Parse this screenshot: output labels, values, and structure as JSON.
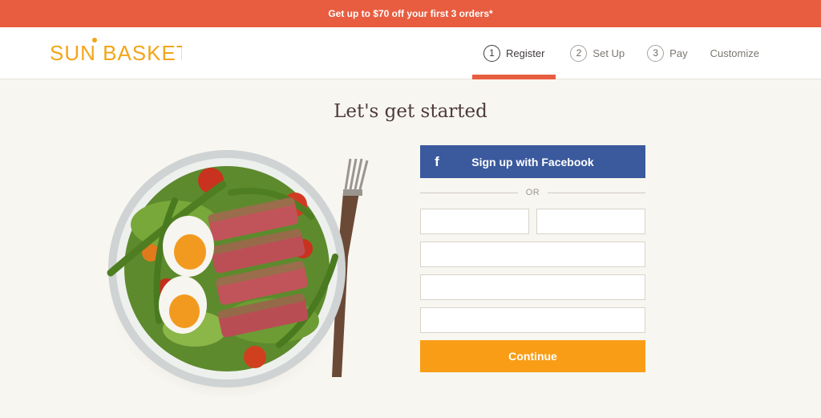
{
  "promo": {
    "text": "Get up to $70 off your first 3 orders*"
  },
  "brand": {
    "logo_text": "SUN BASKET",
    "color": "#f2a51a"
  },
  "steps": [
    {
      "number": "1",
      "label": "Register",
      "active": true
    },
    {
      "number": "2",
      "label": "Set Up",
      "active": false
    },
    {
      "number": "3",
      "label": "Pay",
      "active": false
    },
    {
      "label": "Customize",
      "active": false
    }
  ],
  "page": {
    "title": "Let's get started"
  },
  "form": {
    "facebook_icon": "f",
    "facebook_label": "Sign up with Facebook",
    "divider_text": "OR",
    "first_name": {
      "value": "",
      "placeholder": ""
    },
    "last_name": {
      "value": "",
      "placeholder": ""
    },
    "email": {
      "value": "",
      "placeholder": ""
    },
    "password": {
      "value": "",
      "placeholder": ""
    },
    "zip": {
      "value": "",
      "placeholder": ""
    },
    "continue_label": "Continue"
  },
  "colors": {
    "promo_bg": "#e85d40",
    "facebook": "#3b5a9d",
    "continue": "#fa9d16",
    "active_step_underline": "#e85d40"
  },
  "icons": {
    "facebook": "facebook-f-icon",
    "hero": "salad-bowl-image"
  }
}
